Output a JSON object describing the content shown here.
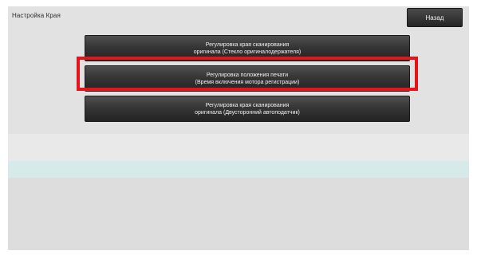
{
  "header": {
    "title": "Настройка Края",
    "back_label": "Назад"
  },
  "menu": {
    "items": [
      {
        "line1": "Регулировка края сканирования",
        "line2": "оригинала (Стекло оригиналодержателя)"
      },
      {
        "line1": "Регулировка положения печати",
        "line2": "(Время включения мотора регистрации)"
      },
      {
        "line1": "Регулировка края сканирования",
        "line2": "оригинала (Двусторонний автоподатчик)"
      }
    ],
    "highlighted_index": 1
  },
  "colors": {
    "highlight": "#e5141b",
    "button_top": "#505050",
    "button_bottom": "#232323",
    "screen_bg": "#e2e2e2",
    "band_cyan": "#d6eaea"
  }
}
